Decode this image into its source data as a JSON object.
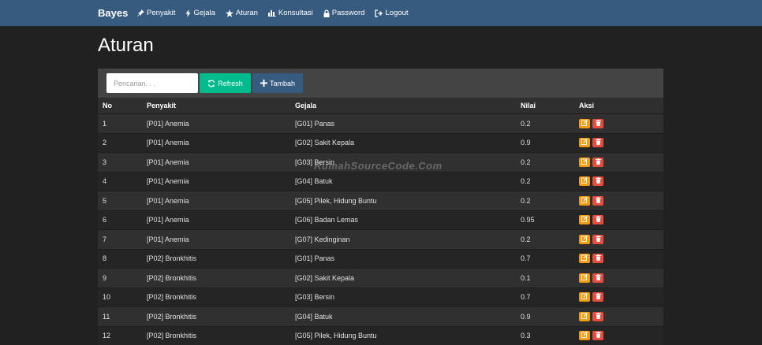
{
  "nav": {
    "brand": "Bayes",
    "items": [
      {
        "label": "Penyakit",
        "icon": "pushpin-icon"
      },
      {
        "label": "Gejala",
        "icon": "flash-icon"
      },
      {
        "label": "Aturan",
        "icon": "star-icon"
      },
      {
        "label": "Konsultasi",
        "icon": "stats-icon"
      },
      {
        "label": "Password",
        "icon": "lock-icon"
      },
      {
        "label": "Logout",
        "icon": "logout-icon"
      }
    ]
  },
  "page": {
    "title": "Aturan"
  },
  "toolbar": {
    "search_placeholder": "Pencarian. . .",
    "refresh_label": "Refresh",
    "add_label": "Tambah"
  },
  "table": {
    "headers": [
      "No",
      "Penyakit",
      "Gejala",
      "Nilai",
      "Aksi"
    ],
    "rows": [
      {
        "no": "1",
        "penyakit": "[P01] Anemia",
        "gejala": "[G01] Panas",
        "nilai": "0.2"
      },
      {
        "no": "2",
        "penyakit": "[P01] Anemia",
        "gejala": "[G02] Sakit Kepala",
        "nilai": "0.9"
      },
      {
        "no": "3",
        "penyakit": "[P01] Anemia",
        "gejala": "[G03] Bersin",
        "nilai": "0.2"
      },
      {
        "no": "4",
        "penyakit": "[P01] Anemia",
        "gejala": "[G04] Batuk",
        "nilai": "0.2"
      },
      {
        "no": "5",
        "penyakit": "[P01] Anemia",
        "gejala": "[G05] Pilek, Hidung Buntu",
        "nilai": "0.2"
      },
      {
        "no": "6",
        "penyakit": "[P01] Anemia",
        "gejala": "[G06] Badan Lemas",
        "nilai": "0.95"
      },
      {
        "no": "7",
        "penyakit": "[P01] Anemia",
        "gejala": "[G07] Kedinginan",
        "nilai": "0.2"
      },
      {
        "no": "8",
        "penyakit": "[P02] Bronkhitis",
        "gejala": "[G01] Panas",
        "nilai": "0.7"
      },
      {
        "no": "9",
        "penyakit": "[P02] Bronkhitis",
        "gejala": "[G02] Sakit Kepala",
        "nilai": "0.1"
      },
      {
        "no": "10",
        "penyakit": "[P02] Bronkhitis",
        "gejala": "[G03] Bersin",
        "nilai": "0.7"
      },
      {
        "no": "11",
        "penyakit": "[P02] Bronkhitis",
        "gejala": "[G04] Batuk",
        "nilai": "0.9"
      },
      {
        "no": "12",
        "penyakit": "[P02] Bronkhitis",
        "gejala": "[G05] Pilek, Hidung Buntu",
        "nilai": "0.3"
      }
    ]
  },
  "watermark": "RumahSourceCode.Com",
  "colors": {
    "navbar": "#375a7f",
    "background": "#212121",
    "refresh": "#00bc8c",
    "add": "#375a7f",
    "edit": "#f39c12",
    "delete": "#e74c3c"
  }
}
